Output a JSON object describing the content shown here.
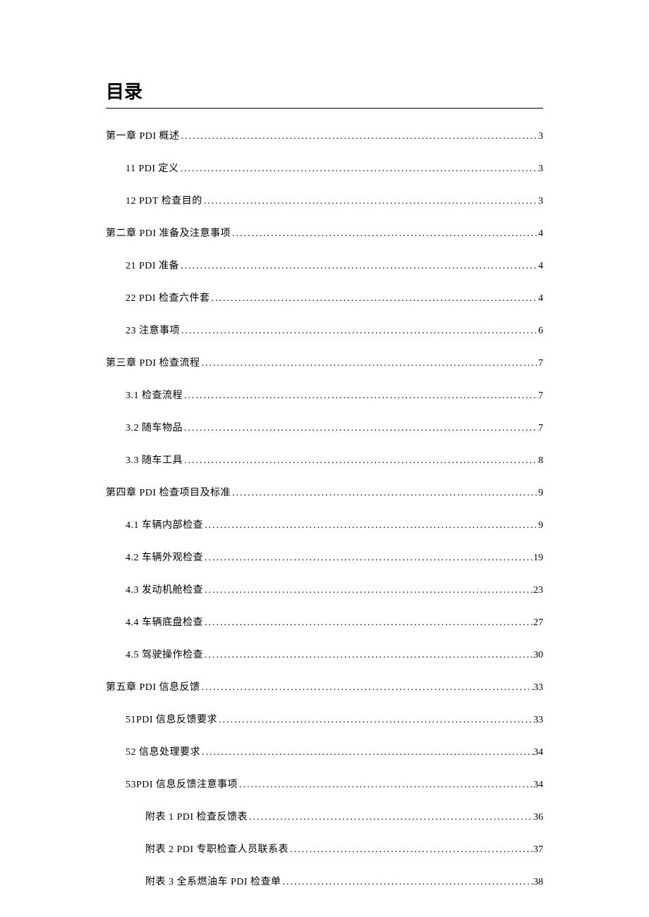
{
  "title": "目录",
  "entries": [
    {
      "level": 0,
      "label": "第一章 PDI 概述",
      "page": "3"
    },
    {
      "level": 1,
      "label": "11  PDI 定义",
      "page": "3"
    },
    {
      "level": 1,
      "label": "12  PDT 检查目的",
      "page": "3"
    },
    {
      "level": 0,
      "label": "第二章 PDI 准备及注意事项",
      "page": "4"
    },
    {
      "level": 1,
      "label": "21  PDI 准备",
      "page": "4"
    },
    {
      "level": 1,
      "label": "22  PDI 检查六件套",
      "page": "4"
    },
    {
      "level": 1,
      "label": "23 注意事项",
      "page": "6"
    },
    {
      "level": 0,
      "label": "第三章 PDI 检查流程",
      "page": "7"
    },
    {
      "level": 1,
      "label": "3.1 检查流程",
      "page": "7"
    },
    {
      "level": 1,
      "label": "3.2 随车物品",
      "page": "7"
    },
    {
      "level": 1,
      "label": "3.3 随车工具",
      "page": "8"
    },
    {
      "level": 0,
      "label": "第四章 PDI 检查项目及标准",
      "page": "9"
    },
    {
      "level": 1,
      "label": "4.1 车辆内部检查",
      "page": "9"
    },
    {
      "level": 1,
      "label": "4.2 车辆外观检查",
      "page": "19"
    },
    {
      "level": 1,
      "label": "4.3 发动机舱检查",
      "page": "23"
    },
    {
      "level": 1,
      "label": "4.4 车辆底盘检查",
      "page": "27"
    },
    {
      "level": 1,
      "label": "4.5 驾驶操作检查",
      "page": "30"
    },
    {
      "level": 0,
      "label": "第五章 PDI 信息反馈",
      "page": "33"
    },
    {
      "level": 1,
      "label": "51PDI 信息反馈要求",
      "page": "33"
    },
    {
      "level": 1,
      "label": "52 信息处理要求",
      "page": "34"
    },
    {
      "level": 1,
      "label": "53PDI 信息反馈注意事项",
      "page": "34"
    },
    {
      "level": 2,
      "label": "附表 1  PDI 检查反馈表",
      "page": "36"
    },
    {
      "level": 2,
      "label": "附表 2  PDI 专职检查人员联系表",
      "page": "37"
    },
    {
      "level": 2,
      "label": "附表 3 全系燃油车 PDI 检查单",
      "page": "38"
    }
  ]
}
